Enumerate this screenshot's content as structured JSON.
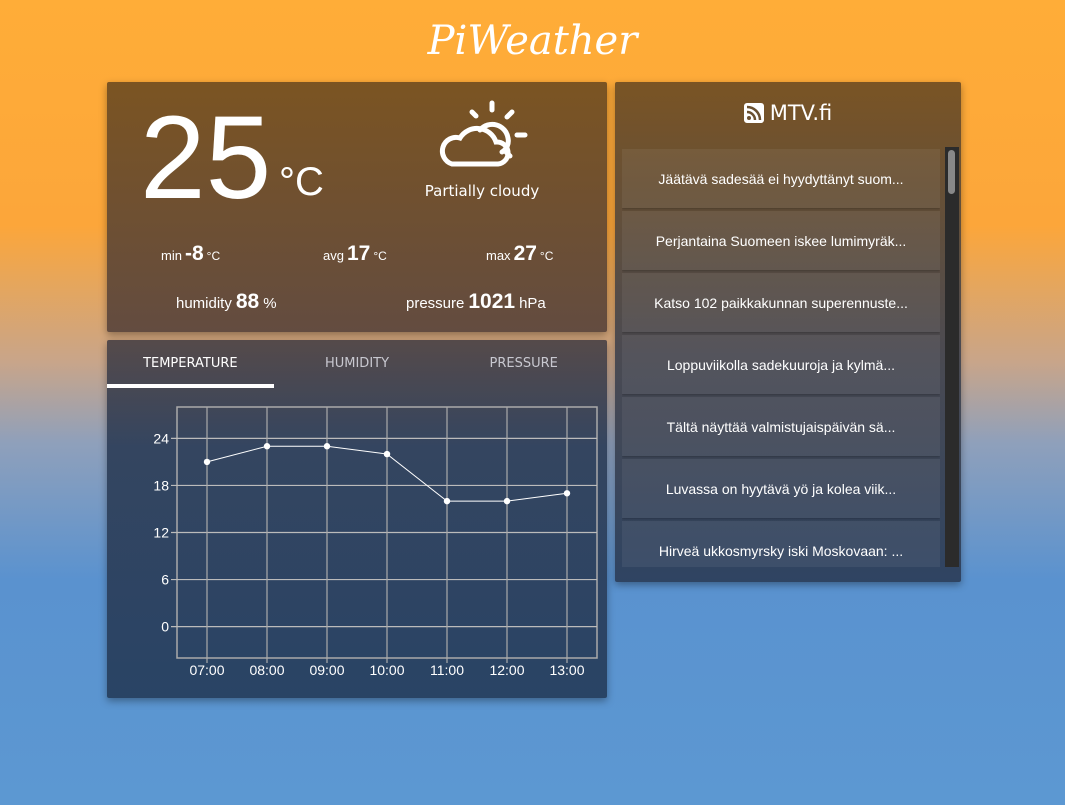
{
  "app": {
    "title": "PiWeather"
  },
  "current": {
    "temperature": "25",
    "unit": "°C",
    "icon": "partly-cloudy-icon",
    "description": "Partially cloudy",
    "min_label": "min",
    "min": "-8",
    "avg_label": "avg",
    "avg": "17",
    "max_label": "max",
    "max": "27",
    "stat_unit": "°C",
    "humidity_label": "humidity",
    "humidity": "88",
    "humidity_unit": "%",
    "pressure_label": "pressure",
    "pressure": "1021",
    "pressure_unit": "hPa"
  },
  "tabs": [
    {
      "label": "TEMPERATURE",
      "active": true
    },
    {
      "label": "HUMIDITY",
      "active": false
    },
    {
      "label": "PRESSURE",
      "active": false
    }
  ],
  "chart_data": {
    "type": "line",
    "categories": [
      "07:00",
      "08:00",
      "09:00",
      "10:00",
      "11:00",
      "12:00",
      "13:00"
    ],
    "values": [
      21,
      23,
      23,
      22,
      16,
      16,
      17
    ],
    "yticks": [
      0,
      6,
      12,
      18,
      24
    ],
    "ylim": [
      -4,
      28
    ],
    "grid": true,
    "xlabel": "",
    "ylabel": "",
    "line_color": "#ffffff"
  },
  "news": {
    "source": "MTV.fi",
    "icon": "rss-icon",
    "items": [
      "Jäätävä sadesää ei hyydyttänyt suom...",
      "Perjantaina Suomeen iskee lumimyräk...",
      "Katso 102 paikkakunnan superennuste...",
      "Loppuviikolla sadekuuroja ja kylmä...",
      "Tältä näyttää valmistujaispäivän sä...",
      "Luvassa on hyytävä yö ja kolea viik...",
      "Hirveä ukkosmyrsky iski Moskovaan: ..."
    ]
  }
}
